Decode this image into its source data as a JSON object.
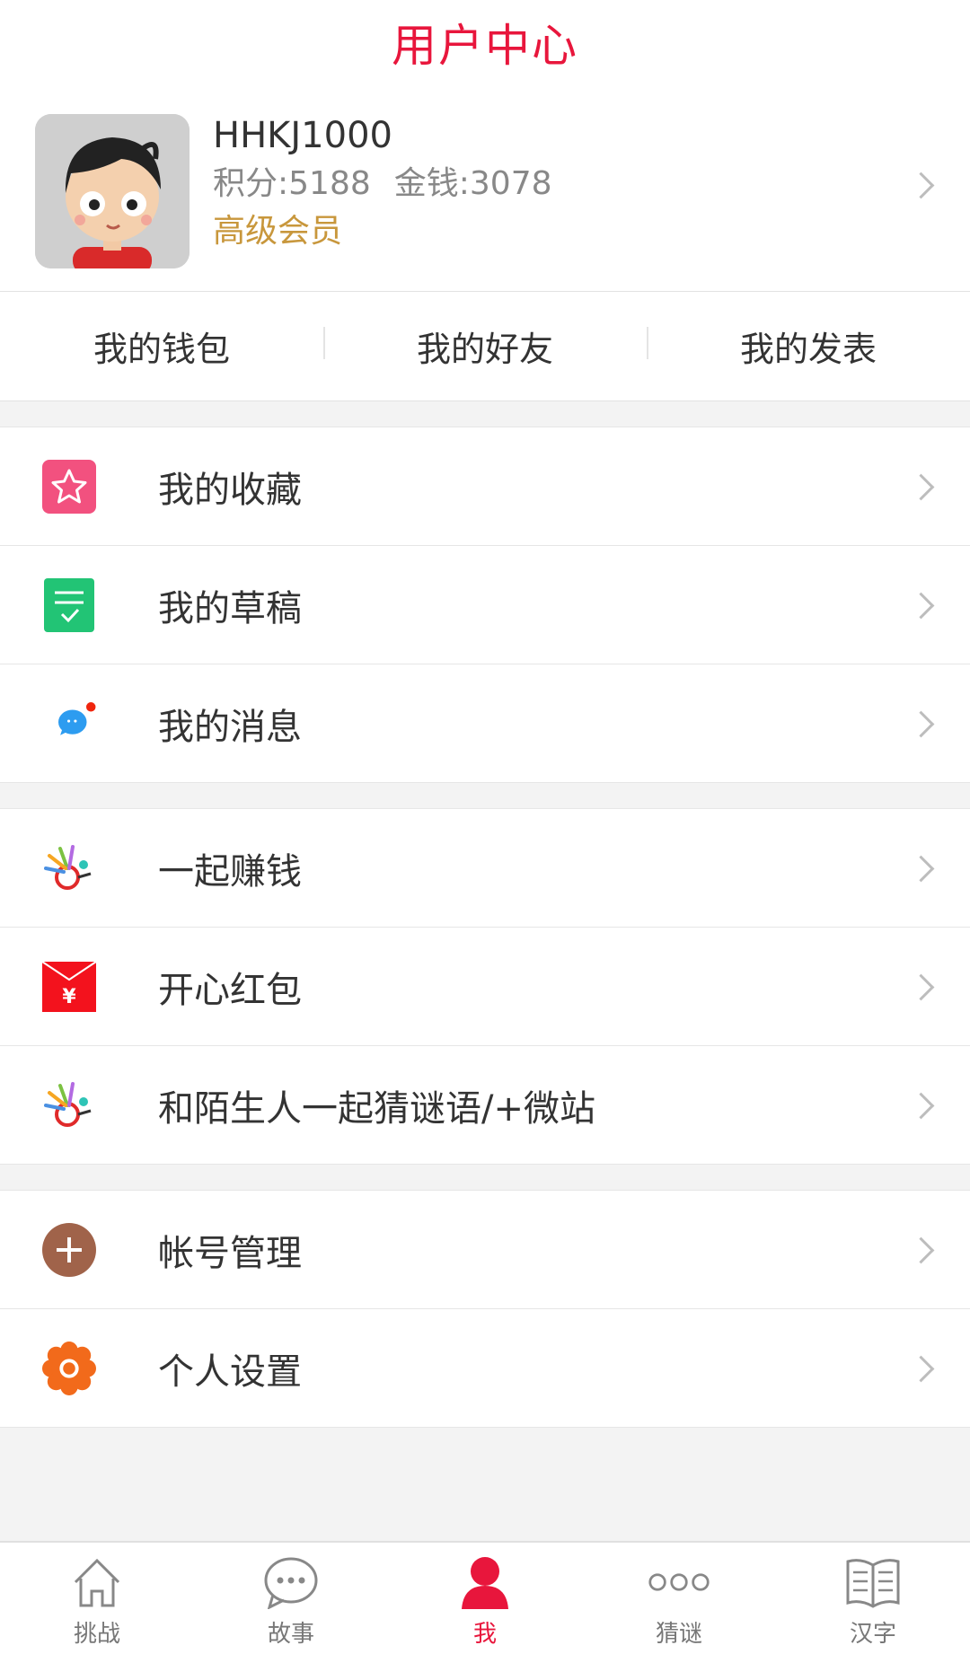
{
  "header": {
    "title": "用户中心"
  },
  "profile": {
    "username": "HHKJ1000",
    "points": "积分:5188",
    "money": "金钱:3078",
    "level": "高级会员"
  },
  "quick": [
    "我的钱包",
    "我的好友",
    "我的发表"
  ],
  "groups": [
    [
      {
        "label": "我的收藏",
        "icon": "star-icon"
      },
      {
        "label": "我的草稿",
        "icon": "draft-icon"
      },
      {
        "label": "我的消息",
        "icon": "message-icon"
      }
    ],
    [
      {
        "label": "一起赚钱",
        "icon": "fan-icon"
      },
      {
        "label": "开心红包",
        "icon": "red-envelope-icon"
      },
      {
        "label": "和陌生人一起猜谜语/+微站",
        "icon": "fan-icon"
      }
    ],
    [
      {
        "label": "帐号管理",
        "icon": "plus-circle-icon"
      },
      {
        "label": "个人设置",
        "icon": "gear-icon"
      }
    ]
  ],
  "tabs": [
    {
      "label": "挑战",
      "icon": "home-icon"
    },
    {
      "label": "故事",
      "icon": "chat-bubble-icon"
    },
    {
      "label": "我",
      "icon": "person-icon",
      "active": true
    },
    {
      "label": "猜谜",
      "icon": "circles-icon"
    },
    {
      "label": "汉字",
      "icon": "book-icon"
    }
  ],
  "colors": {
    "accent": "#e8163c",
    "level": "#c8973c"
  }
}
